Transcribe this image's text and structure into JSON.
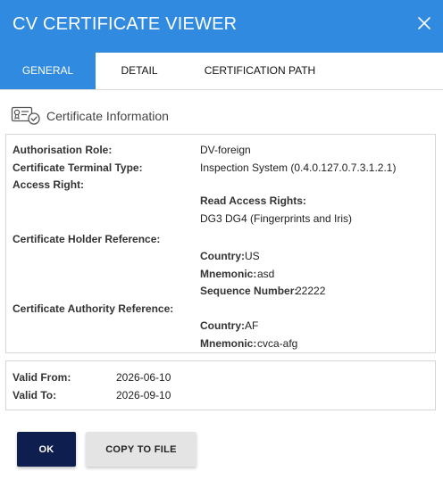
{
  "dialog": {
    "title": "CV CERTIFICATE VIEWER"
  },
  "tabs": [
    {
      "label": "GENERAL",
      "active": true
    },
    {
      "label": "DETAIL",
      "active": false
    },
    {
      "label": "CERTIFICATION PATH",
      "active": false
    }
  ],
  "section": {
    "title": "Certificate Information",
    "icon": "certificate-icon"
  },
  "info": {
    "authorisation_role_label": "Authorisation Role:",
    "authorisation_role_value": "DV-foreign",
    "terminal_type_label": "Certificate Terminal Type:",
    "terminal_type_value": "Inspection System (0.4.0.127.0.7.3.1.2.1)",
    "access_right_label": "Access Right:",
    "read_access_label": "Read Access Rights:",
    "read_access_value": "DG3 DG4 (Fingerprints and Iris)",
    "holder_ref_label": "Certificate Holder Reference:",
    "holder_country_label": "Country:",
    "holder_country_value": "US",
    "holder_mnemonic_label": "Mnemonic:",
    "holder_mnemonic_value": "asd",
    "holder_sequence_label": "Sequence Number:",
    "holder_sequence_value": "22222",
    "authority_ref_label": "Certificate Authority Reference:",
    "authority_country_label": "Country:",
    "authority_country_value": "AF",
    "authority_mnemonic_label": "Mnemonic:",
    "authority_mnemonic_value": "cvca-afg"
  },
  "validity": {
    "from_label": "Valid From:",
    "from_value": "2026-06-10",
    "to_label": "Valid To:",
    "to_value": "2026-09-10"
  },
  "buttons": {
    "ok": "OK",
    "copy": "COPY TO FILE"
  },
  "colors": {
    "accent": "#2f8ae0",
    "primary_button": "#0e1f4f",
    "secondary_button": "#e4e4e4"
  }
}
